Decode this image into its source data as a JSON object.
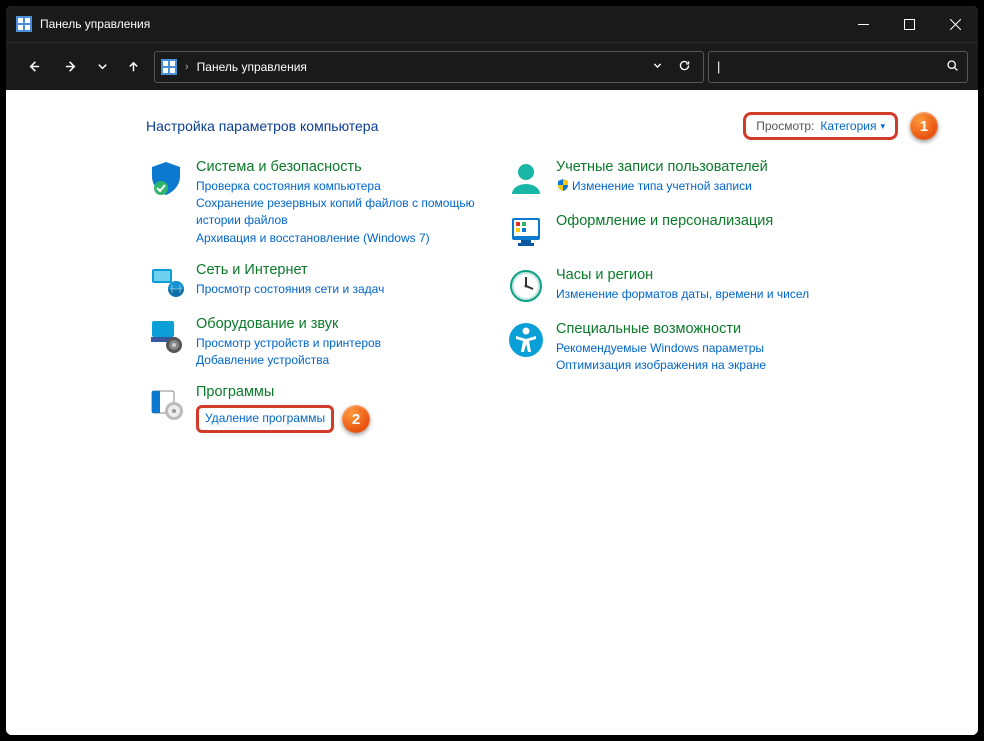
{
  "window": {
    "title": "Панель управления"
  },
  "addressbar": {
    "path": "Панель управления"
  },
  "search": {
    "placeholder": ""
  },
  "heading": "Настройка параметров компьютера",
  "view": {
    "label": "Просмотр:",
    "value": "Категория"
  },
  "callouts": {
    "one": "1",
    "two": "2"
  },
  "left": {
    "system": {
      "title": "Система и безопасность",
      "links": [
        "Проверка состояния компьютера",
        "Сохранение резервных копий файлов с помощью истории файлов",
        "Архивация и восстановление (Windows 7)"
      ]
    },
    "network": {
      "title": "Сеть и Интернет",
      "links": [
        "Просмотр состояния сети и задач"
      ]
    },
    "hardware": {
      "title": "Оборудование и звук",
      "links": [
        "Просмотр устройств и принтеров",
        "Добавление устройства"
      ]
    },
    "programs": {
      "title": "Программы",
      "uninstall": "Удаление программы"
    }
  },
  "right": {
    "accounts": {
      "title": "Учетные записи пользователей",
      "links": [
        "Изменение типа учетной записи"
      ]
    },
    "appearance": {
      "title": "Оформление и персонализация"
    },
    "clock": {
      "title": "Часы и регион",
      "links": [
        "Изменение форматов даты, времени и чисел"
      ]
    },
    "access": {
      "title": "Специальные возможности",
      "links": [
        "Рекомендуемые Windows параметры",
        "Оптимизация изображения на экране"
      ]
    }
  }
}
